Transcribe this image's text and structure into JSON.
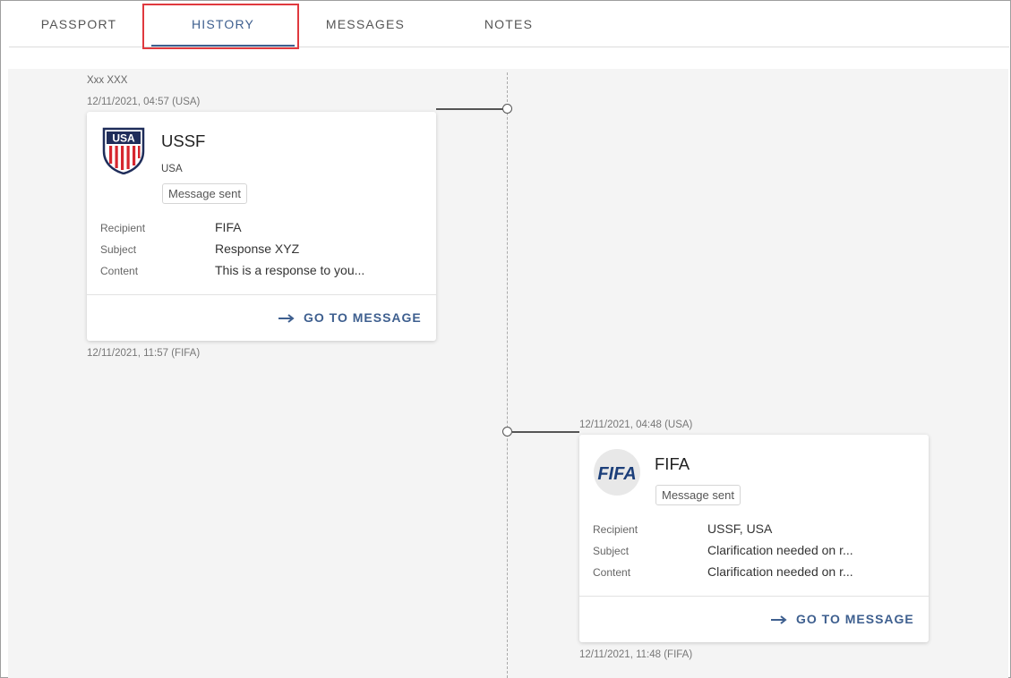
{
  "tabs": [
    {
      "label": "PASSPORT"
    },
    {
      "label": "HISTORY"
    },
    {
      "label": "MESSAGES"
    },
    {
      "label": "NOTES"
    }
  ],
  "colors": {
    "accent": "#3e5f8f",
    "highlight": "#e0393e"
  },
  "timeline": {
    "entries": [
      {
        "author": "Xxx XXX",
        "timestamp_top": "12/11/2021, 04:57 (USA)",
        "timestamp_bottom": "12/11/2021, 11:57 (FIFA)",
        "org": "USSF",
        "country": "USA",
        "status": "Message sent",
        "fields": [
          {
            "label": "Recipient",
            "value": "FIFA"
          },
          {
            "label": "Subject",
            "value": "Response XYZ"
          },
          {
            "label": "Content",
            "value": "This is a response to you..."
          }
        ],
        "action": "GO TO MESSAGE",
        "logo_icon": "ussf-crest-icon",
        "logo_text": "USA"
      },
      {
        "timestamp_top": "12/11/2021, 04:48 (USA)",
        "timestamp_bottom": "12/11/2021, 11:48 (FIFA)",
        "org": "FIFA",
        "status": "Message sent",
        "fields": [
          {
            "label": "Recipient",
            "value": "USSF, USA"
          },
          {
            "label": "Subject",
            "value": "Clarification needed on r..."
          },
          {
            "label": "Content",
            "value": "Clarification needed on r..."
          }
        ],
        "action": "GO TO MESSAGE",
        "logo_icon": "fifa-logo-icon",
        "logo_text": "FIFA"
      }
    ]
  }
}
